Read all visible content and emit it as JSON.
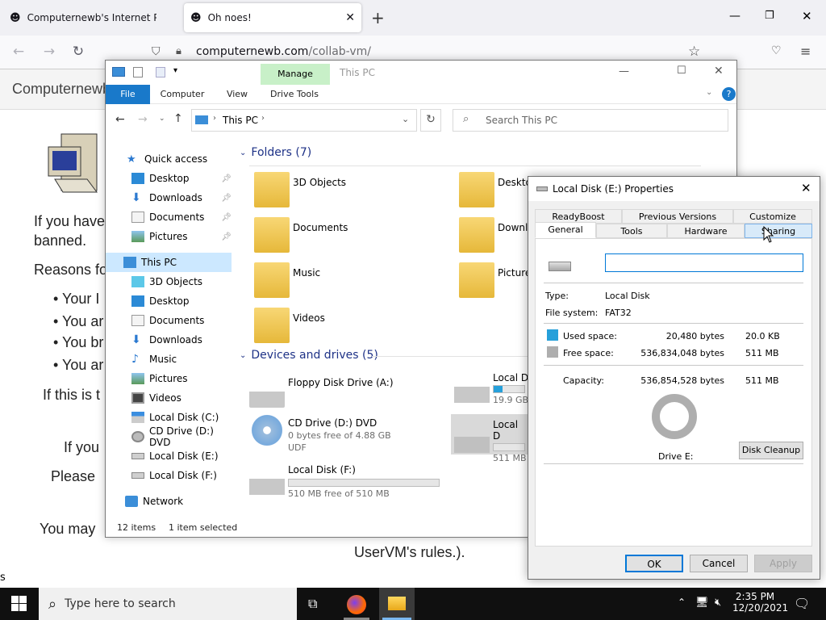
{
  "browser": {
    "tabs": [
      {
        "title": "Computernewb's Internet Pub",
        "active": false
      },
      {
        "title": "Oh noes!",
        "active": true
      }
    ],
    "url_host": "computernewb.com",
    "url_path": "/collab-vm/"
  },
  "page": {
    "heading": "Computernewb",
    "lines": [
      "If you have",
      "banned.",
      "Reasons fo",
      "Your I",
      "You ar",
      "You br",
      "You ar",
      "If this is t",
      "If you",
      "Please",
      "You may",
      "UserVM's rules.)."
    ],
    "corner": "s"
  },
  "explorer": {
    "title": "This PC",
    "manage_label": "Manage",
    "ribbon_tabs": [
      "File",
      "Computer",
      "View",
      "Drive Tools"
    ],
    "address": "This PC",
    "search_placeholder": "Search This PC",
    "nav": {
      "quick_access": "Quick access",
      "quick": [
        "Desktop",
        "Downloads",
        "Documents",
        "Pictures"
      ],
      "this_pc": "This PC",
      "pc_items": [
        "3D Objects",
        "Desktop",
        "Documents",
        "Downloads",
        "Music",
        "Pictures",
        "Videos",
        "Local Disk (C:)",
        "CD Drive (D:) DVD",
        "Local Disk (E:)",
        "Local Disk (F:)"
      ],
      "network": "Network"
    },
    "folders_header": "Folders (7)",
    "folders": [
      "3D Objects",
      "Desktop",
      "Documents",
      "Downlo",
      "Music",
      "Pictures",
      "Videos"
    ],
    "devices_header": "Devices and drives (5)",
    "drives": [
      {
        "name": "Floppy Disk Drive (A:)",
        "sub": ""
      },
      {
        "name": "Local D",
        "sub": "19.9 GB",
        "fill": 0.3
      },
      {
        "name": "CD Drive (D:) DVD",
        "sub": "0 bytes free of 4.88 GB",
        "sub2": "UDF"
      },
      {
        "name": "Local D",
        "sub": "511 MB",
        "fill": 0
      },
      {
        "name": "Local Disk (F:)",
        "sub": "510 MB free of 510 MB",
        "fill": 0
      }
    ],
    "status_count": "12 items",
    "status_sel": "1 item selected"
  },
  "dialog": {
    "title": "Local Disk (E:) Properties",
    "tabs_row1": [
      "ReadyBoost",
      "Previous Versions",
      "Customize"
    ],
    "tabs_row2": [
      "General",
      "Tools",
      "Hardware",
      "Sharing"
    ],
    "name_value": "",
    "type_label": "Type:",
    "type_value": "Local Disk",
    "fs_label": "File system:",
    "fs_value": "FAT32",
    "used_label": "Used space:",
    "used_bytes": "20,480 bytes",
    "used_h": "20.0 KB",
    "free_label": "Free space:",
    "free_bytes": "536,834,048 bytes",
    "free_h": "511 MB",
    "cap_label": "Capacity:",
    "cap_bytes": "536,854,528 bytes",
    "cap_h": "511 MB",
    "drive_label": "Drive E:",
    "cleanup": "Disk Cleanup",
    "ok": "OK",
    "cancel": "Cancel",
    "apply": "Apply",
    "used_color": "#26a0da",
    "free_color": "#aeaeae"
  },
  "taskbar": {
    "search_placeholder": "Type here to search",
    "time": "2:35 PM",
    "date": "12/20/2021"
  }
}
